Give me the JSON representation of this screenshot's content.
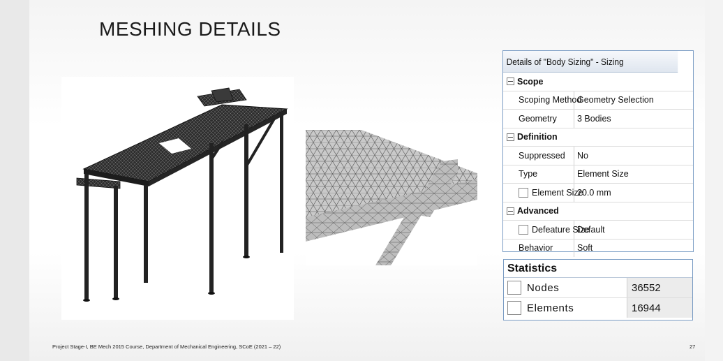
{
  "slide": {
    "title": "MESHING DETAILS",
    "footer": "Project Stage-I, BE Mech 2015 Course, Department of Mechanical Engineering, SCoE (2021 – 22)",
    "page_number": "27"
  },
  "details": {
    "header": "Details of \"Body Sizing\" - Sizing",
    "groups": {
      "scope": "Scope",
      "definition": "Definition",
      "advanced": "Advanced"
    },
    "rows": {
      "scoping_method": {
        "key": "Scoping Method",
        "value": "Geometry Selection"
      },
      "geometry": {
        "key": "Geometry",
        "value": "3 Bodies"
      },
      "suppressed": {
        "key": "Suppressed",
        "value": "No"
      },
      "type": {
        "key": "Type",
        "value": "Element Size"
      },
      "element_size": {
        "key": "Element Size",
        "value": "20.0 mm"
      },
      "defeature_size": {
        "key": "Defeature Size",
        "value": "Default"
      },
      "behavior": {
        "key": "Behavior",
        "value": "Soft"
      }
    }
  },
  "statistics": {
    "header": "Statistics",
    "nodes": {
      "key": "Nodes",
      "value": "36552"
    },
    "elements": {
      "key": "Elements",
      "value": "16944"
    }
  }
}
